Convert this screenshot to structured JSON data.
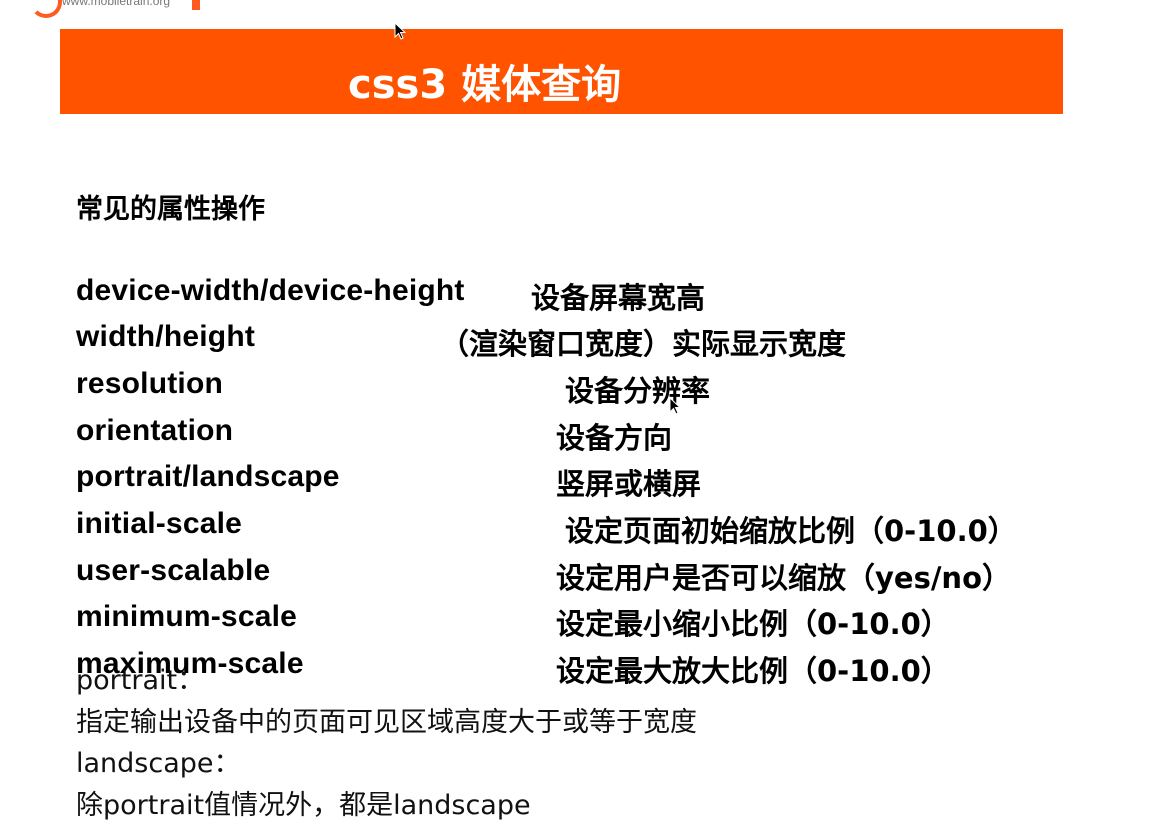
{
  "logo": {
    "text": "www.mobiletrain.org"
  },
  "header": {
    "title": "css3 媒体查询"
  },
  "section": {
    "title": "常见的属性操作"
  },
  "properties": [
    {
      "name": "device-width/device-height",
      "desc": "设备屏幕宽高"
    },
    {
      "name": "width/height",
      "desc": "（渲染窗口宽度）实际显示宽度"
    },
    {
      "name": "resolution",
      "desc": "设备分辨率"
    },
    {
      "name": "orientation",
      "desc": "设备方向"
    },
    {
      "name": "portrait/landscape",
      "desc": "竖屏或横屏"
    },
    {
      "name": "initial-scale",
      "desc": "设定页面初始缩放比例（0-10.0）"
    },
    {
      "name": "user-scalable",
      "desc": "设定用户是否可以缩放（yes/no）"
    },
    {
      "name": "minimum-scale",
      "desc": "设定最小缩小比例（0-10.0）"
    },
    {
      "name": "maximum-scale",
      "desc": "设定最大放大比例（0-10.0）"
    }
  ],
  "notes": {
    "portrait_label": "portrait：",
    "portrait_desc": "指定输出设备中的页面可见区域高度大于或等于宽度",
    "landscape_label": "landscape：",
    "landscape_desc": "除portrait值情况外，都是landscape"
  },
  "colors": {
    "accent": "#ff5300",
    "text": "#000000",
    "background": "#ffffff"
  }
}
